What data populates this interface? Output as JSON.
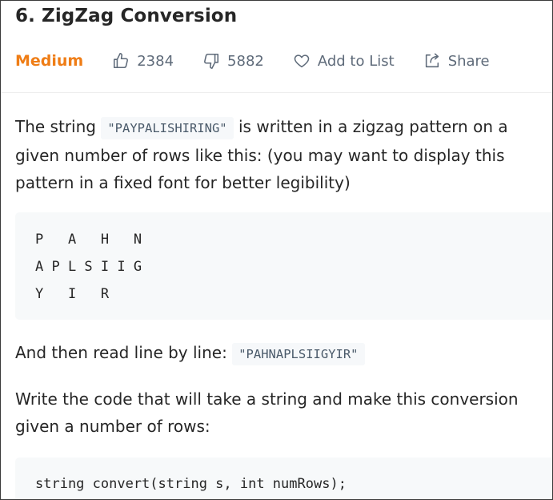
{
  "problem": {
    "title": "6. ZigZag Conversion",
    "difficulty": "Medium",
    "likes": "2384",
    "dislikes": "5882",
    "add_to_list_label": "Add to List",
    "share_label": "Share"
  },
  "description": {
    "p1_before": "The string ",
    "p1_code": "\"PAYPALISHIRING\"",
    "p1_after": " is written in a zigzag pattern on a given number of rows like this: (you may want to display this pattern in a fixed font for better legibility)",
    "example_lines": [
      "P   A   H   N",
      "A P L S I I G",
      "Y   I   R"
    ],
    "p2_before": "And then read line by line: ",
    "p2_code": "\"PAHNAPLSIIGYIR\"",
    "p3": "Write the code that will take a string and make this conversion given a number of rows:",
    "signature": "string convert(string s, int numRows);"
  },
  "colors": {
    "difficulty_medium": "#ef7d16",
    "meta_text": "#5f6b7a",
    "code_bg": "#f7f9fa",
    "inline_code_bg": "#f6f8fa",
    "text": "#262626"
  },
  "icons": {
    "like": "thumbs-up-icon",
    "dislike": "thumbs-down-icon",
    "add_to_list": "heart-icon",
    "share": "share-icon"
  }
}
